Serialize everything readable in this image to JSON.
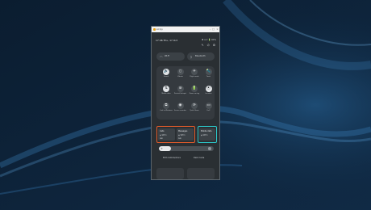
{
  "window": {
    "title": "scrcpy"
  },
  "status": {
    "time_date": "17:46  Thu, 17 Oct",
    "icons": "✱ ⊙ ▾ 🔋 64%"
  },
  "tools": {
    "edit": "✎",
    "power": "⏻",
    "settings": "⚙"
  },
  "top_pills": [
    {
      "icon": "wifi",
      "label": "Wi-Fi"
    },
    {
      "icon": "bluetooth",
      "label": "Bluetooth"
    }
  ],
  "tiles": [
    {
      "label": "Sound",
      "glyph": "🔊",
      "on": true
    },
    {
      "label": "Vibrate",
      "glyph": "▯",
      "on": false
    },
    {
      "label": "Flight mode",
      "glyph": "✈",
      "on": false
    },
    {
      "label": "Torch",
      "glyph": "🔦",
      "on": false
    },
    {
      "label": "Mobile data",
      "glyph": "⇅",
      "on": true
    },
    {
      "label": "Portrait Hotspot",
      "glyph": "⊚",
      "on": false
    },
    {
      "label": "Power saving",
      "glyph": "🔋",
      "on": false
    },
    {
      "label": "Location",
      "glyph": "⦿",
      "on": true
    },
    {
      "label": "Link to Windows",
      "glyph": "⧉",
      "on": false
    },
    {
      "label": "Screen recorder",
      "glyph": "◉",
      "on": false
    },
    {
      "label": "Quick Share",
      "glyph": "⟳",
      "on": false
    },
    {
      "label": "DeX",
      "glyph": "▭",
      "on": false
    }
  ],
  "sim_cards": [
    {
      "title": "Calls",
      "row1": "◉ SIM 1",
      "row2": "Ask"
    },
    {
      "title": "Messages",
      "row1": "◉ SIM 1",
      "row2": "Ask"
    },
    {
      "title": "Mobile data",
      "row1": "◉ SIM 1",
      "row2": ""
    }
  ],
  "brightness": {
    "level": 0.22,
    "glyph": "☀"
  },
  "bottom": {
    "left_label": "Edit controls/more",
    "right_label": "Dark mode"
  },
  "colors": {
    "highlight_orange": "#e25b2a",
    "highlight_teal": "#2cc7c9",
    "panel": "#2a2f33"
  }
}
